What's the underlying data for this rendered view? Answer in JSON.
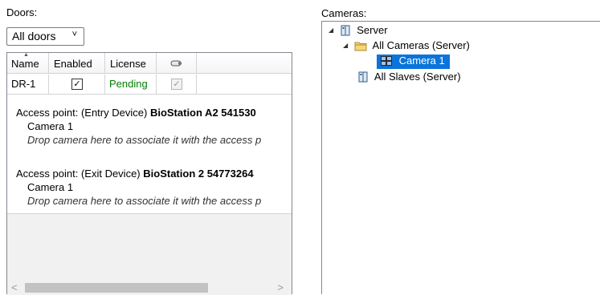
{
  "doors": {
    "label": "Doors:",
    "filter": {
      "selected": "All doors",
      "chevron": "˅"
    },
    "columns": {
      "name": "Name",
      "enabled": "Enabled",
      "license": "License",
      "camera_icon": "camera-icon"
    },
    "rows": [
      {
        "name": "DR-1",
        "enabled": true,
        "enabled_mark": "✓",
        "license": "Pending",
        "camera_mark": "✓",
        "license_color": "#008000"
      }
    ],
    "access_points": [
      {
        "prefix": "Access point:",
        "device_type": "(Entry Device)",
        "device": "BioStation A2 541530",
        "camera": "Camera 1",
        "drop_hint": "Drop camera here to associate it with the access p"
      },
      {
        "prefix": "Access point:",
        "device_type": "(Exit Device)",
        "device": "BioStation 2 54773264",
        "camera": "Camera 1",
        "drop_hint": "Drop camera here to associate it with the access p"
      }
    ],
    "scroll": {
      "left_arrow": "<",
      "right_arrow": ">"
    }
  },
  "cameras": {
    "label": "Cameras:",
    "tree": {
      "server": "Server",
      "all_cameras": "All Cameras (Server)",
      "camera1": "Camera 1",
      "all_slaves": "All Slaves (Server)",
      "expander": "◢"
    },
    "selection_color": "#0a74da"
  }
}
